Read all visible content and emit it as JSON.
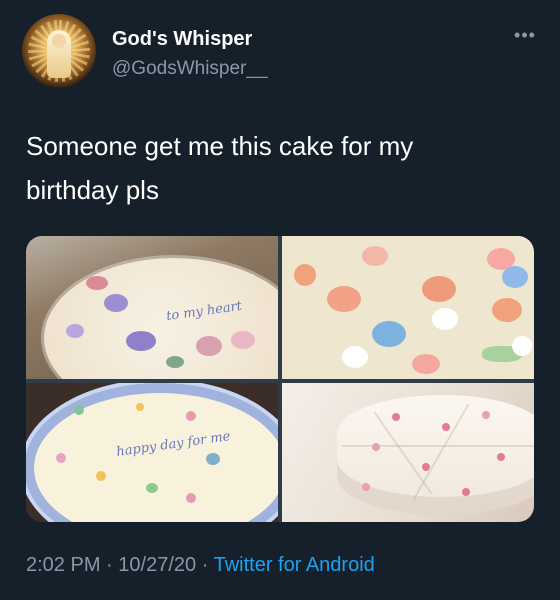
{
  "tweet": {
    "display_name": "God's Whisper",
    "handle": "@GodsWhisper__",
    "more_icon": "more-horizontal-icon",
    "text_line1": "Someone get me this cake for my",
    "text_line2": "birthday pls",
    "time": "2:02 PM",
    "date": "10/27/20",
    "separator": "·",
    "source": "Twitter for Android"
  },
  "media": {
    "image_count": 4,
    "cake_writing_1": "to my heart",
    "cake_writing_2": "happy day for me"
  },
  "colors": {
    "background": "#15202b",
    "primary_text": "#ffffff",
    "secondary_text": "#8899a6",
    "link": "#1da1f2"
  }
}
